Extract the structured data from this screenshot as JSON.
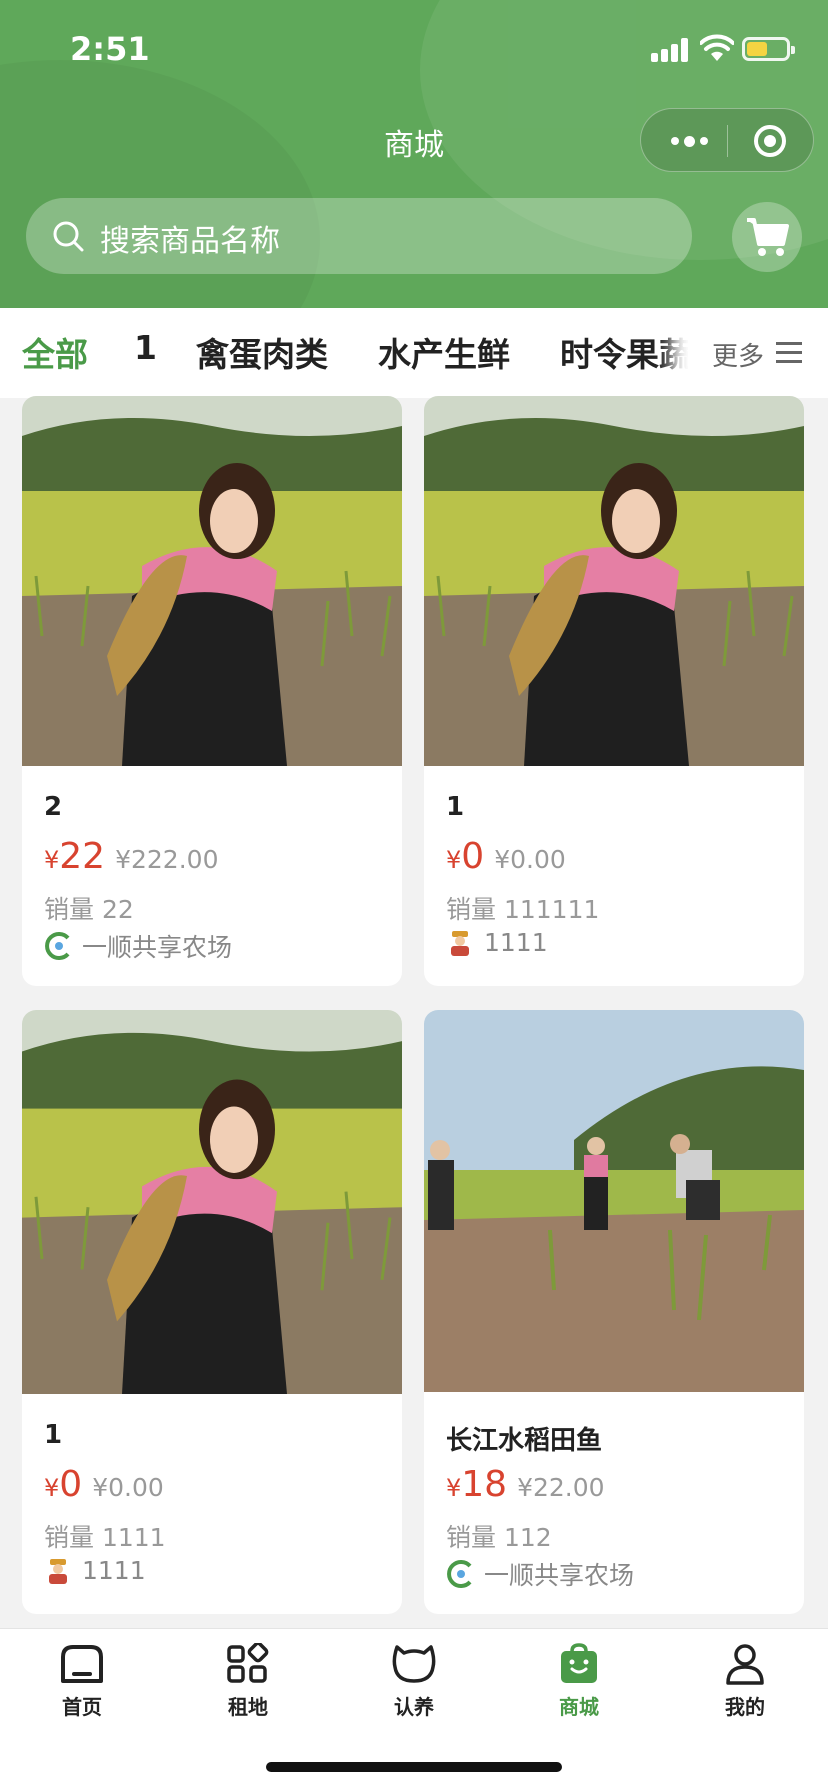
{
  "status_bar": {
    "time": "2:51"
  },
  "header": {
    "title": "商城"
  },
  "search": {
    "placeholder": "搜索商品名称"
  },
  "categories": {
    "tabs": [
      "全部",
      "1",
      "禽蛋肉类",
      "水产生鲜",
      "时令果蔬"
    ],
    "active_index": 0,
    "more_label": "更多"
  },
  "products": [
    {
      "name": "2",
      "currency": "¥",
      "price": "22",
      "original_price": "¥222.00",
      "sales": "销量 22",
      "seller": "一顺共享农场",
      "seller_icon": "farm-logo-icon",
      "image": "woman-holding-fish-in-paddy"
    },
    {
      "name": "1",
      "currency": "¥",
      "price": "0",
      "original_price": "¥0.00",
      "sales": "销量 111111",
      "seller": "1111",
      "seller_icon": "farmer-avatar-icon",
      "image": "woman-holding-fish-in-paddy"
    },
    {
      "name": "1",
      "currency": "¥",
      "price": "0",
      "original_price": "¥0.00",
      "sales": "销量 1111",
      "seller": "1111",
      "seller_icon": "farmer-avatar-icon",
      "image": "woman-holding-fish-in-paddy"
    },
    {
      "name": "长江水稻田鱼",
      "currency": "¥",
      "price": "18",
      "original_price": "¥22.00",
      "sales": "销量 112",
      "seller": "一顺共享农场",
      "seller_icon": "farm-logo-icon",
      "image": "people-fishing-in-paddy"
    }
  ],
  "tabbar": {
    "items": [
      {
        "label": "首页",
        "icon": "home-icon"
      },
      {
        "label": "租地",
        "icon": "grid-icon"
      },
      {
        "label": "认养",
        "icon": "pet-icon"
      },
      {
        "label": "商城",
        "icon": "shop-bag-icon"
      },
      {
        "label": "我的",
        "icon": "user-icon"
      }
    ],
    "active_index": 3
  },
  "colors": {
    "brand_green": "#5fa85a",
    "active_green": "#4a9a48",
    "price_red": "#d8432f"
  }
}
